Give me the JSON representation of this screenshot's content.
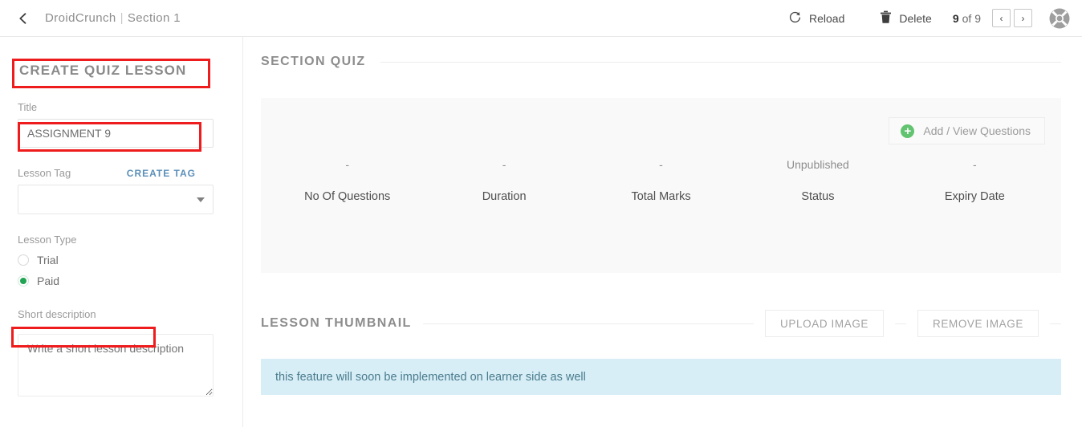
{
  "topbar": {
    "back_icon": "chevron-left-icon",
    "breadcrumb_app": "DroidCrunch",
    "breadcrumb_sep": "|",
    "breadcrumb_section": "Section 1",
    "reload_label": "Reload",
    "reload_icon": "refresh-icon",
    "delete_label": "Delete",
    "delete_icon": "trash-icon",
    "pager_current": "9",
    "pager_of": "of 9",
    "prev_icon": "chevron-left-icon",
    "next_icon": "chevron-right-icon",
    "prev_glyph": "‹",
    "next_glyph": "›",
    "avatar_icon": "lifebuoy-help-icon"
  },
  "sidebar": {
    "panel_title": "CREATE QUIZ LESSON",
    "title_label": "Title",
    "title_value": "ASSIGNMENT 9",
    "title_placeholder": "Title",
    "lesson_tag_label": "Lesson Tag",
    "create_tag_label": "CREATE TAG",
    "tag_select_value": "",
    "lesson_type_label": "Lesson Type",
    "lesson_type_options": [
      {
        "label": "Trial",
        "selected": false
      },
      {
        "label": "Paid",
        "selected": true
      }
    ],
    "short_description_label": "Short description",
    "short_description_value": "",
    "short_description_placeholder": "Write a short lesson description"
  },
  "main": {
    "section_quiz_title": "SECTION QUIZ",
    "add_view_questions_label": "Add / View Questions",
    "add_icon": "plus-circle-icon",
    "stats": [
      {
        "value": "-",
        "label": "No Of Questions"
      },
      {
        "value": "-",
        "label": "Duration"
      },
      {
        "value": "-",
        "label": "Total Marks"
      },
      {
        "value": "Unpublished",
        "label": "Status"
      },
      {
        "value": "-",
        "label": "Expiry Date"
      }
    ],
    "lesson_thumbnail_title": "LESSON THUMBNAIL",
    "upload_image_label": "UPLOAD IMAGE",
    "remove_image_label": "REMOVE IMAGE",
    "alert_text": "this feature will soon be implemented on learner side as well"
  },
  "colors": {
    "accent_green": "#21a453",
    "plus_green": "#62c370",
    "link_blue": "#5b8fb9",
    "alert_bg": "#d7eef7",
    "alert_text": "#4a7b8c",
    "annotation_red": "#ee1c1c",
    "card_bg": "#f9f9f9"
  }
}
